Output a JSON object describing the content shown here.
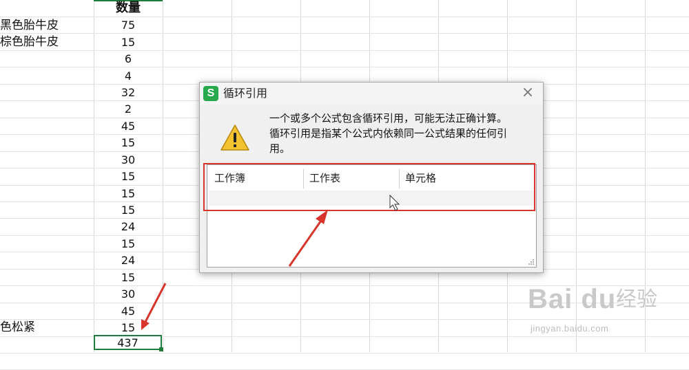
{
  "sheet": {
    "header": "数量",
    "names": [
      {
        "row": 1,
        "text": "黑色胎牛皮"
      },
      {
        "row": 2,
        "text": "棕色胎牛皮"
      },
      {
        "row": 19,
        "text": "色松紧"
      }
    ],
    "quantities": [
      "75",
      "15",
      "6",
      "4",
      "32",
      "2",
      "45",
      "15",
      "30",
      "15",
      "15",
      "15",
      "24",
      "15",
      "24",
      "15",
      "30",
      "45",
      "15"
    ],
    "total": "437"
  },
  "dialog": {
    "title": "循环引用",
    "app_icon_letter": "S",
    "close_symbol": "×",
    "message_lines": [
      "一个或多个公式包含循环引用，可能无法正确计算。",
      "循环引用是指某个公式内依赖同一公式结果的任何引",
      "用。"
    ],
    "columns": [
      "工作簿",
      "工作表",
      "单元格"
    ]
  },
  "watermark": {
    "logo": "Bai du",
    "cn": "经验",
    "url": "jingyan.baidu.com"
  },
  "colors": {
    "accent_green": "#1e7d3a",
    "annotation_red": "#d9342b",
    "warning_yellow": "#f2c230"
  }
}
